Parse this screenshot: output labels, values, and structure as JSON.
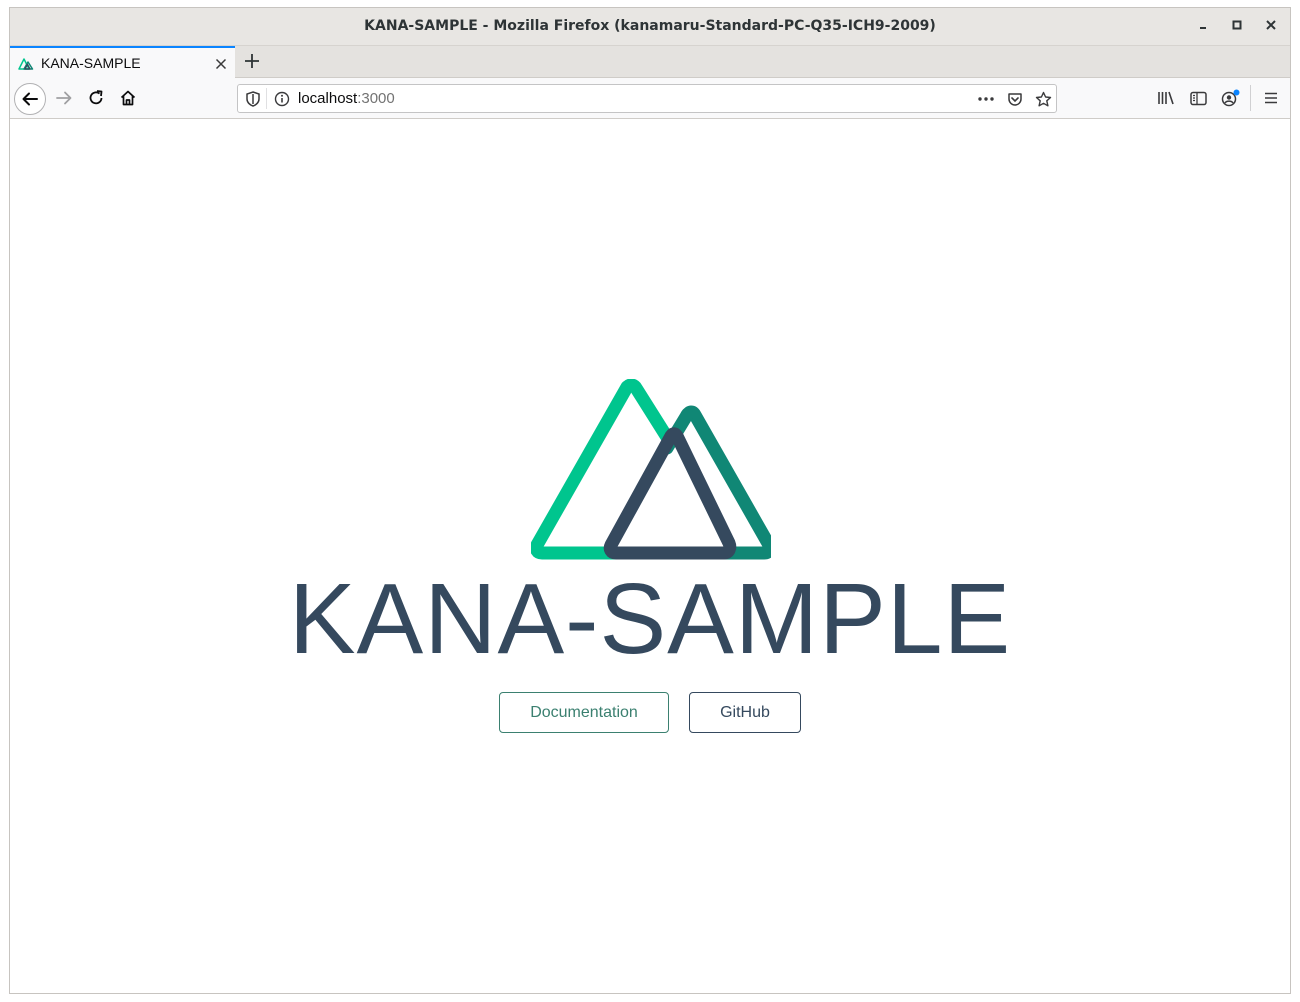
{
  "window": {
    "title": "KANA-SAMPLE - Mozilla Firefox (kanamaru-Standard-PC-Q35-ICH9-2009)"
  },
  "tabs": [
    {
      "title": "KANA-SAMPLE",
      "close_icon": "close-icon",
      "favicon": "nuxt-favicon-icon"
    }
  ],
  "navbar": {
    "url_host": "localhost",
    "url_port": ":3000",
    "icons": [
      "back-icon",
      "forward-icon",
      "reload-icon",
      "home-icon",
      "shield-icon",
      "info-icon",
      "more-icon",
      "pocket-icon",
      "bookmark-star-icon",
      "library-icon",
      "sidebar-icon",
      "account-icon",
      "menu-icon"
    ]
  },
  "page": {
    "heading": "KANA-SAMPLE",
    "buttons": {
      "docs_label": "Documentation",
      "github_label": "GitHub"
    },
    "colors": {
      "text": "#35495e",
      "accent": "#3b8070",
      "logo_green": "#00c58e",
      "logo_teal": "#108775"
    }
  }
}
